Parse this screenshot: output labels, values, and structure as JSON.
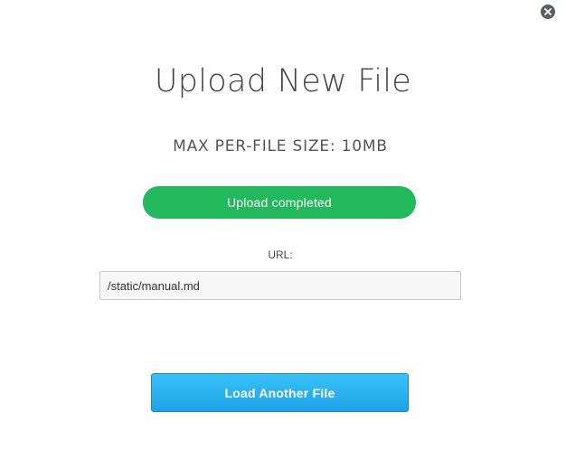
{
  "dialog": {
    "title": "Upload New File",
    "max_size_text": "MAX PER-FILE SIZE: 10MB",
    "close_icon": "close-icon",
    "progress": {
      "label": "Upload completed",
      "percent": 100,
      "color": "#23b85c"
    },
    "url": {
      "label": "URL:",
      "value": "/static/manual.md"
    },
    "load_another_label": "Load Another File",
    "accent_color": "#1ea2e6"
  }
}
